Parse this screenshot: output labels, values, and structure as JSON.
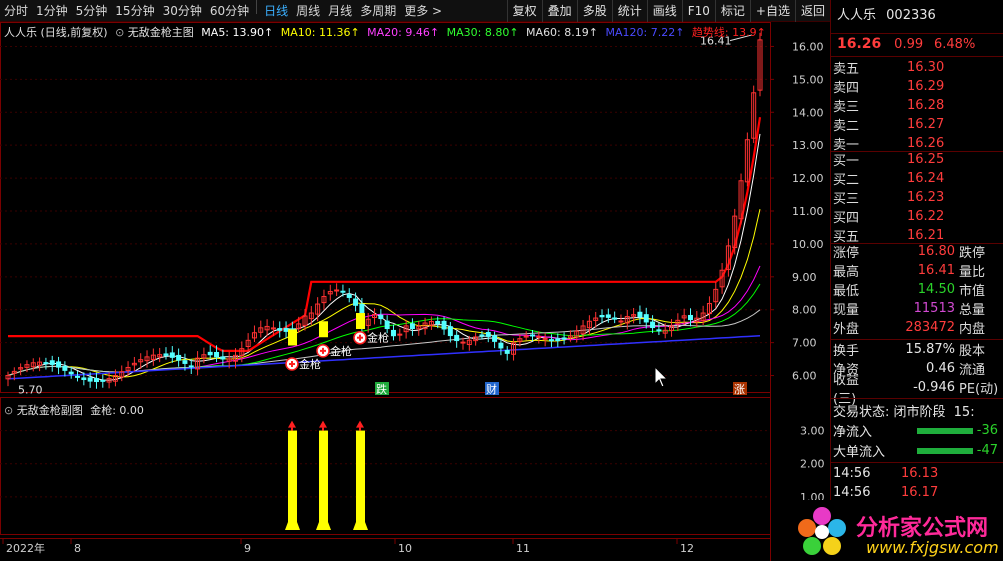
{
  "toolbar": {
    "periods": [
      "分时",
      "1分钟",
      "5分钟",
      "15分钟",
      "30分钟",
      "60分钟",
      "日线",
      "周线",
      "月线",
      "多周期",
      "更多 >"
    ],
    "active_period": "日线",
    "buttons": [
      "复权",
      "叠加",
      "多股",
      "统计",
      "画线",
      "F10",
      "标记",
      "+自选",
      "返回"
    ]
  },
  "main_header": {
    "stock_label": "人人乐 (日线,前复权)",
    "indicator_name": "无敌金枪主图",
    "ma5": "MA5: 13.90↑",
    "ma10": "MA10: 11.36↑",
    "ma20": "MA20: 9.46↑",
    "ma30": "MA30: 8.80↑",
    "ma60": "MA60: 8.19↑",
    "ma120": "MA120: 7.22↑",
    "trend": "趋势线: 13.9↑"
  },
  "sub_header": {
    "indicator_name": "无敌金枪副图",
    "value": "金枪: 0.00"
  },
  "chart_data": {
    "type": "candlestick",
    "price_axis": [
      "16.00",
      "15.00",
      "14.00",
      "13.00",
      "12.00",
      "11.00",
      "10.00",
      "9.00",
      "8.00",
      "7.00",
      "6.00"
    ],
    "sub_axis": [
      "3.00",
      "2.00",
      "1.00"
    ],
    "x_labels": [
      "2022年",
      "8",
      "9",
      "10",
      "11",
      "12"
    ],
    "high_label": "16.41",
    "low_label": "5.70",
    "signal_label": "金枪",
    "events": [
      "跌",
      "财",
      "涨"
    ],
    "ylim": [
      5.5,
      16.5
    ],
    "sub_ylim": [
      0,
      3.5
    ],
    "signals": [
      3,
      3,
      3
    ],
    "colors": {
      "up": "#ff3232",
      "down": "#54ffff",
      "ma5": "#ffffff",
      "ma10": "#ffff00",
      "ma20": "#ff00ff",
      "ma30": "#00ff00",
      "ma60": "#c8c8c8",
      "ma120": "#3030ff",
      "trend": "#ff0000"
    }
  },
  "quote": {
    "name": "人人乐",
    "code": "002336",
    "price": "16.26",
    "change": "0.99",
    "pct": "6.48%",
    "asks": [
      {
        "label": "卖五",
        "price": "16.30"
      },
      {
        "label": "卖四",
        "price": "16.29"
      },
      {
        "label": "卖三",
        "price": "16.28"
      },
      {
        "label": "卖二",
        "price": "16.27"
      },
      {
        "label": "卖一",
        "price": "16.26"
      }
    ],
    "bids": [
      {
        "label": "买一",
        "price": "16.25"
      },
      {
        "label": "买二",
        "price": "16.24"
      },
      {
        "label": "买三",
        "price": "16.23"
      },
      {
        "label": "买四",
        "price": "16.22"
      },
      {
        "label": "买五",
        "price": "16.21"
      }
    ],
    "stats": [
      {
        "label": "涨停",
        "value": "16.80",
        "label2": "跌停"
      },
      {
        "label": "最高",
        "value": "16.41",
        "label2": "量比"
      },
      {
        "label": "最低",
        "value": "14.50",
        "label2": "市值"
      },
      {
        "label": "现量",
        "value": "11513",
        "label2": "总量"
      },
      {
        "label": "外盘",
        "value": "283472",
        "label2": "内盘"
      }
    ],
    "stats2": [
      {
        "label": "换手",
        "value": "15.87%",
        "label2": "股本"
      },
      {
        "label": "净资",
        "value": "0.46",
        "label2": "流通"
      },
      {
        "label": "收益(三)",
        "value": "-0.946",
        "label2": "PE(动)"
      }
    ],
    "trade_status": "交易状态: 闭市阶段",
    "trade_time": "15:",
    "net_inflow": {
      "label": "净流入",
      "value": "-36"
    },
    "big_inflow": {
      "label": "大单流入",
      "value": "-47"
    },
    "ticks": [
      {
        "time": "14:56",
        "price": "16.13"
      },
      {
        "time": "14:56",
        "price": "16.17"
      }
    ]
  },
  "watermark": {
    "brand": "分析家公式网",
    "url": "www.fxjgsw.com"
  }
}
